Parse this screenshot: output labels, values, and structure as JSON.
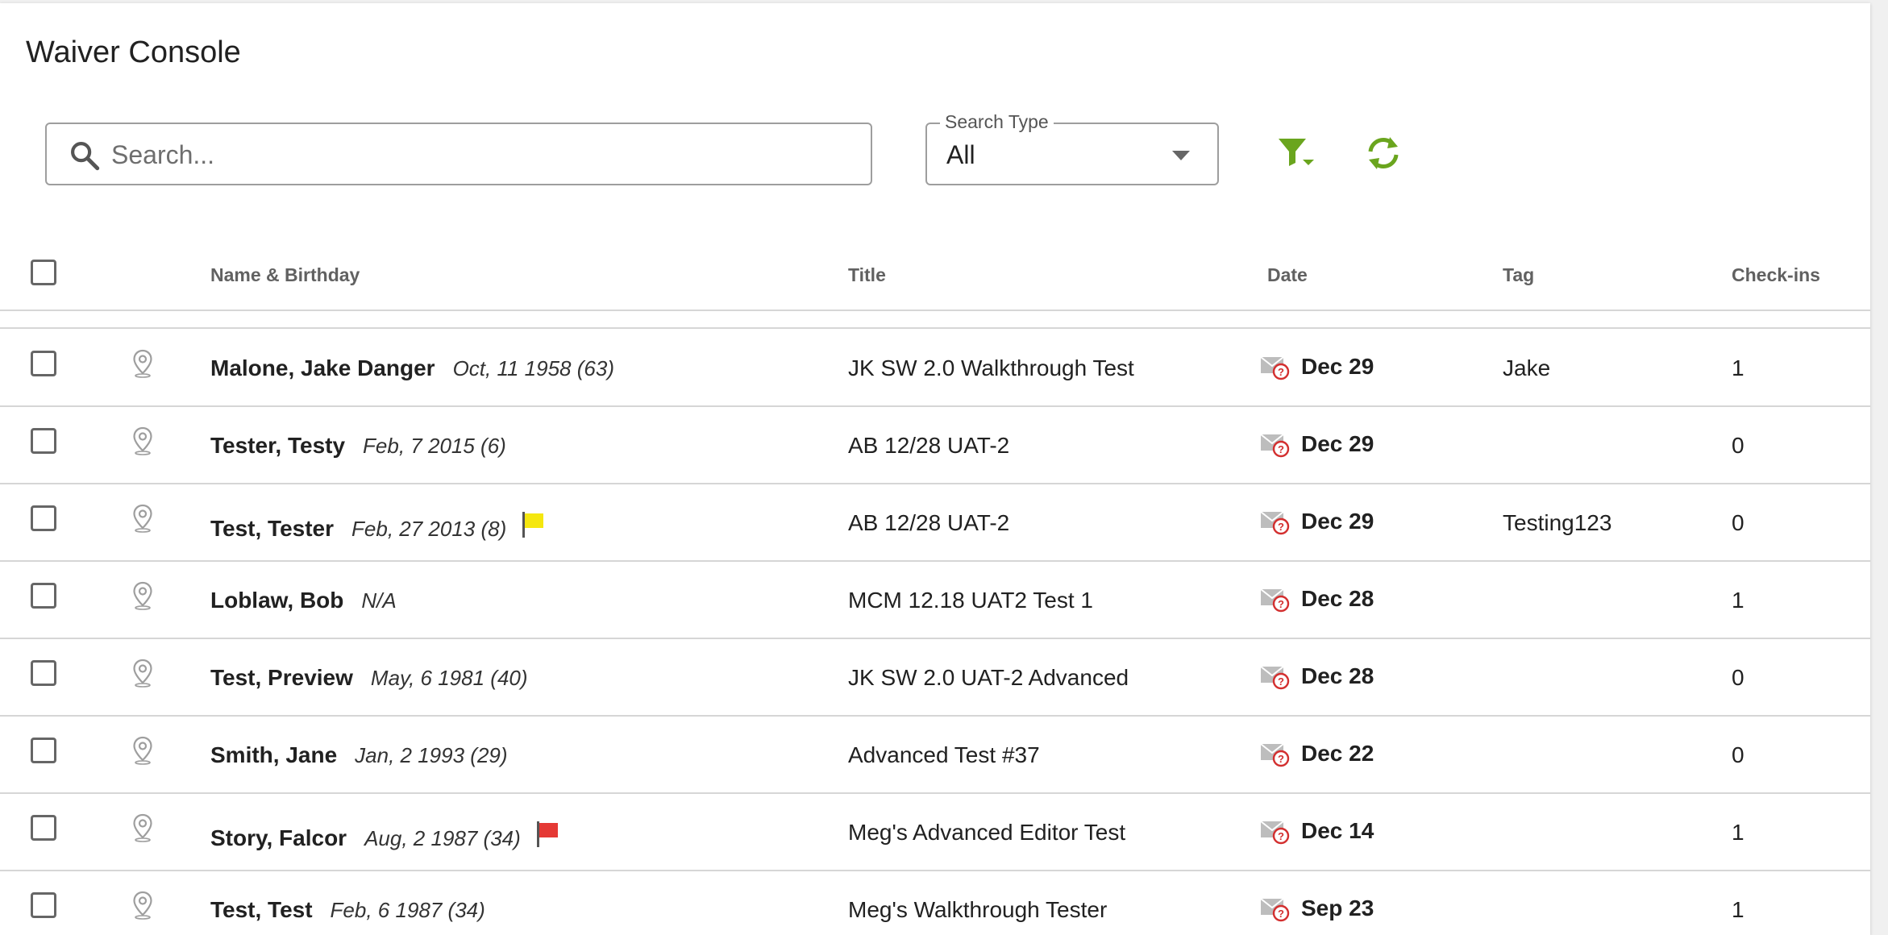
{
  "page": {
    "title": "Waiver Console"
  },
  "search": {
    "placeholder": "Search..."
  },
  "search_type": {
    "label": "Search Type",
    "value": "All"
  },
  "toolbar": {
    "filter_icon": "filter-icon",
    "refresh_icon": "refresh-icon"
  },
  "colors": {
    "accent": "#6aa51e",
    "flag_yellow": "#f5e70f",
    "flag_red": "#e53935",
    "envelope_badge": "#d32f2f"
  },
  "columns": {
    "name": "Name & Birthday",
    "title": "Title",
    "date": "Date",
    "tag": "Tag",
    "checkins": "Check-ins"
  },
  "rows": [
    {
      "name": "Malone, Jake Danger",
      "birthday": "Oct, 11 1958 (63)",
      "flag": "",
      "title": "JK SW 2.0 Walkthrough Test",
      "date": "Dec 29",
      "tag": "Jake",
      "checkins": "1"
    },
    {
      "name": "Tester, Testy",
      "birthday": "Feb, 7 2015 (6)",
      "flag": "",
      "title": "AB 12/28 UAT-2",
      "date": "Dec 29",
      "tag": "",
      "checkins": "0"
    },
    {
      "name": "Test, Tester",
      "birthday": "Feb, 27 2013 (8)",
      "flag": "yellow",
      "title": "AB 12/28 UAT-2",
      "date": "Dec 29",
      "tag": "Testing123",
      "checkins": "0"
    },
    {
      "name": "Loblaw, Bob",
      "birthday": "N/A",
      "flag": "",
      "title": "MCM 12.18 UAT2 Test 1",
      "date": "Dec 28",
      "tag": "",
      "checkins": "1"
    },
    {
      "name": "Test, Preview",
      "birthday": "May, 6 1981 (40)",
      "flag": "",
      "title": "JK SW 2.0 UAT-2 Advanced",
      "date": "Dec 28",
      "tag": "",
      "checkins": "0"
    },
    {
      "name": "Smith, Jane",
      "birthday": "Jan, 2 1993 (29)",
      "flag": "",
      "title": "Advanced Test #37",
      "date": "Dec 22",
      "tag": "",
      "checkins": "0"
    },
    {
      "name": "Story, Falcor",
      "birthday": "Aug, 2 1987 (34)",
      "flag": "red",
      "title": "Meg's Advanced Editor Test",
      "date": "Dec 14",
      "tag": "",
      "checkins": "1"
    },
    {
      "name": "Test, Test",
      "birthday": "Feb, 6 1987 (34)",
      "flag": "",
      "title": "Meg's Walkthrough Tester",
      "date": "Sep 23",
      "tag": "",
      "checkins": "1"
    }
  ]
}
